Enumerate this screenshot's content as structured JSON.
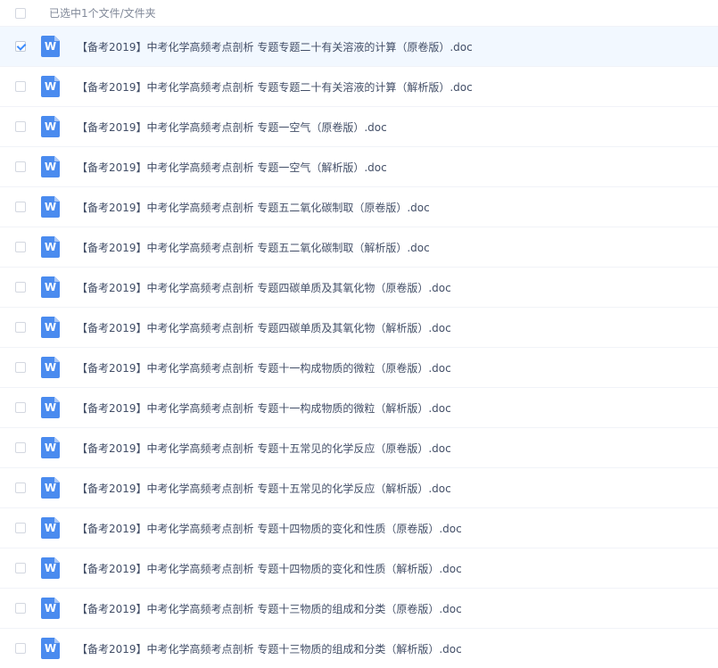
{
  "header": {
    "selection_text": "已选中1个文件/文件夹"
  },
  "icon_letter": "W",
  "files": [
    {
      "name": "【备考2019】中考化学高频考点剖析 专题专题二十有关溶液的计算（原卷版）.doc",
      "checked": true
    },
    {
      "name": "【备考2019】中考化学高频考点剖析 专题专题二十有关溶液的计算（解析版）.doc",
      "checked": false
    },
    {
      "name": "【备考2019】中考化学高频考点剖析 专题一空气（原卷版）.doc",
      "checked": false
    },
    {
      "name": "【备考2019】中考化学高频考点剖析 专题一空气（解析版）.doc",
      "checked": false
    },
    {
      "name": "【备考2019】中考化学高频考点剖析 专题五二氧化碳制取（原卷版）.doc",
      "checked": false
    },
    {
      "name": "【备考2019】中考化学高频考点剖析 专题五二氧化碳制取（解析版）.doc",
      "checked": false
    },
    {
      "name": "【备考2019】中考化学高频考点剖析 专题四碳单质及其氧化物（原卷版）.doc",
      "checked": false
    },
    {
      "name": "【备考2019】中考化学高频考点剖析 专题四碳单质及其氧化物（解析版）.doc",
      "checked": false
    },
    {
      "name": "【备考2019】中考化学高频考点剖析 专题十一构成物质的微粒（原卷版）.doc",
      "checked": false
    },
    {
      "name": "【备考2019】中考化学高频考点剖析 专题十一构成物质的微粒（解析版）.doc",
      "checked": false
    },
    {
      "name": "【备考2019】中考化学高频考点剖析 专题十五常见的化学反应（原卷版）.doc",
      "checked": false
    },
    {
      "name": "【备考2019】中考化学高频考点剖析 专题十五常见的化学反应（解析版）.doc",
      "checked": false
    },
    {
      "name": "【备考2019】中考化学高频考点剖析 专题十四物质的变化和性质（原卷版）.doc",
      "checked": false
    },
    {
      "name": "【备考2019】中考化学高频考点剖析 专题十四物质的变化和性质（解析版）.doc",
      "checked": false
    },
    {
      "name": "【备考2019】中考化学高频考点剖析 专题十三物质的组成和分类（原卷版）.doc",
      "checked": false
    },
    {
      "name": "【备考2019】中考化学高频考点剖析 专题十三物质的组成和分类（解析版）.doc",
      "checked": false
    }
  ]
}
